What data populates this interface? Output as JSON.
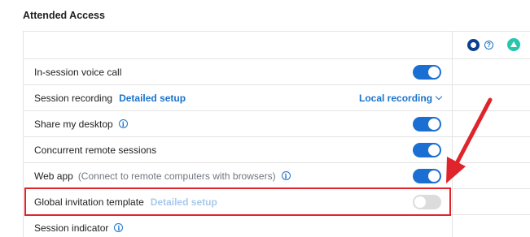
{
  "section": {
    "title": "Attended Access"
  },
  "rows": [
    {
      "label": "In-session voice call",
      "toggle": "on"
    },
    {
      "label": "Session recording",
      "link": "Detailed setup",
      "dropdown": "Local recording"
    },
    {
      "label": "Share my desktop",
      "info": "i",
      "toggle": "on"
    },
    {
      "label": "Concurrent remote sessions",
      "toggle": "on"
    },
    {
      "label": "Web app",
      "hint": "(Connect to remote computers with browsers)",
      "info": "i",
      "toggle": "on"
    },
    {
      "label": "Global invitation template",
      "link": "Detailed setup",
      "toggle": "off"
    },
    {
      "label": "Session indicator",
      "info": "i"
    }
  ],
  "header_icons": [
    "settings-icon",
    "help-icon",
    "upload-icon"
  ],
  "header_help_glyph": "?",
  "colors": {
    "accent": "#1b6fd3",
    "toggle_off": "#dcdcdc",
    "highlight": "#e0242c",
    "teal": "#27c7ad"
  }
}
